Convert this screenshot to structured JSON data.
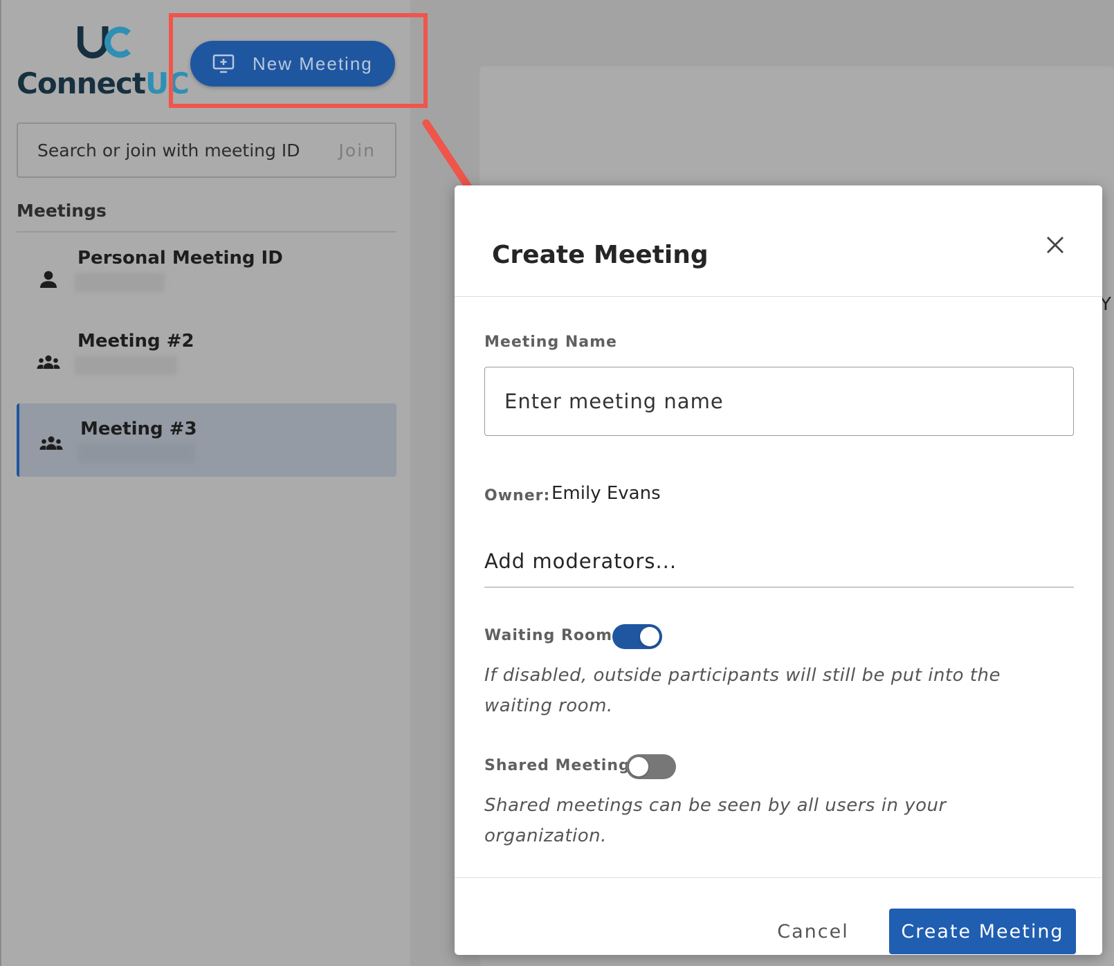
{
  "app": {
    "brand_logo_text": "ConnectUC",
    "new_meeting_label": "New Meeting"
  },
  "search": {
    "placeholder": "Search or join with meeting ID",
    "join_label": "Join"
  },
  "sidebar": {
    "heading": "Meetings",
    "items": [
      {
        "label": "Personal Meeting ID",
        "icon": "person-icon",
        "active": false
      },
      {
        "label": "Meeting #2",
        "icon": "group-icon",
        "active": false
      },
      {
        "label": "Meeting #3",
        "icon": "group-icon",
        "active": true
      }
    ]
  },
  "dialog": {
    "title": "Create Meeting",
    "meeting_name_label": "Meeting Name",
    "meeting_name_placeholder": "Enter meeting name",
    "owner_label": "Owner:",
    "owner_value": "Emily Evans",
    "moderators_placeholder": "Add moderators...",
    "waiting_room_label": "Waiting Room:",
    "waiting_room_enabled": true,
    "waiting_room_help": "If disabled, outside participants will still be put into the waiting room.",
    "shared_meeting_label": "Shared Meeting:",
    "shared_meeting_enabled": false,
    "shared_meeting_help": "Shared meetings can be seen by all users in your organization.",
    "cancel_label": "Cancel",
    "create_label": "Create Meeting"
  },
  "colors": {
    "accent": "#1f56a0",
    "highlight": "#f0554b",
    "logo_dark": "#16303f",
    "logo_light": "#2f8fb4"
  }
}
